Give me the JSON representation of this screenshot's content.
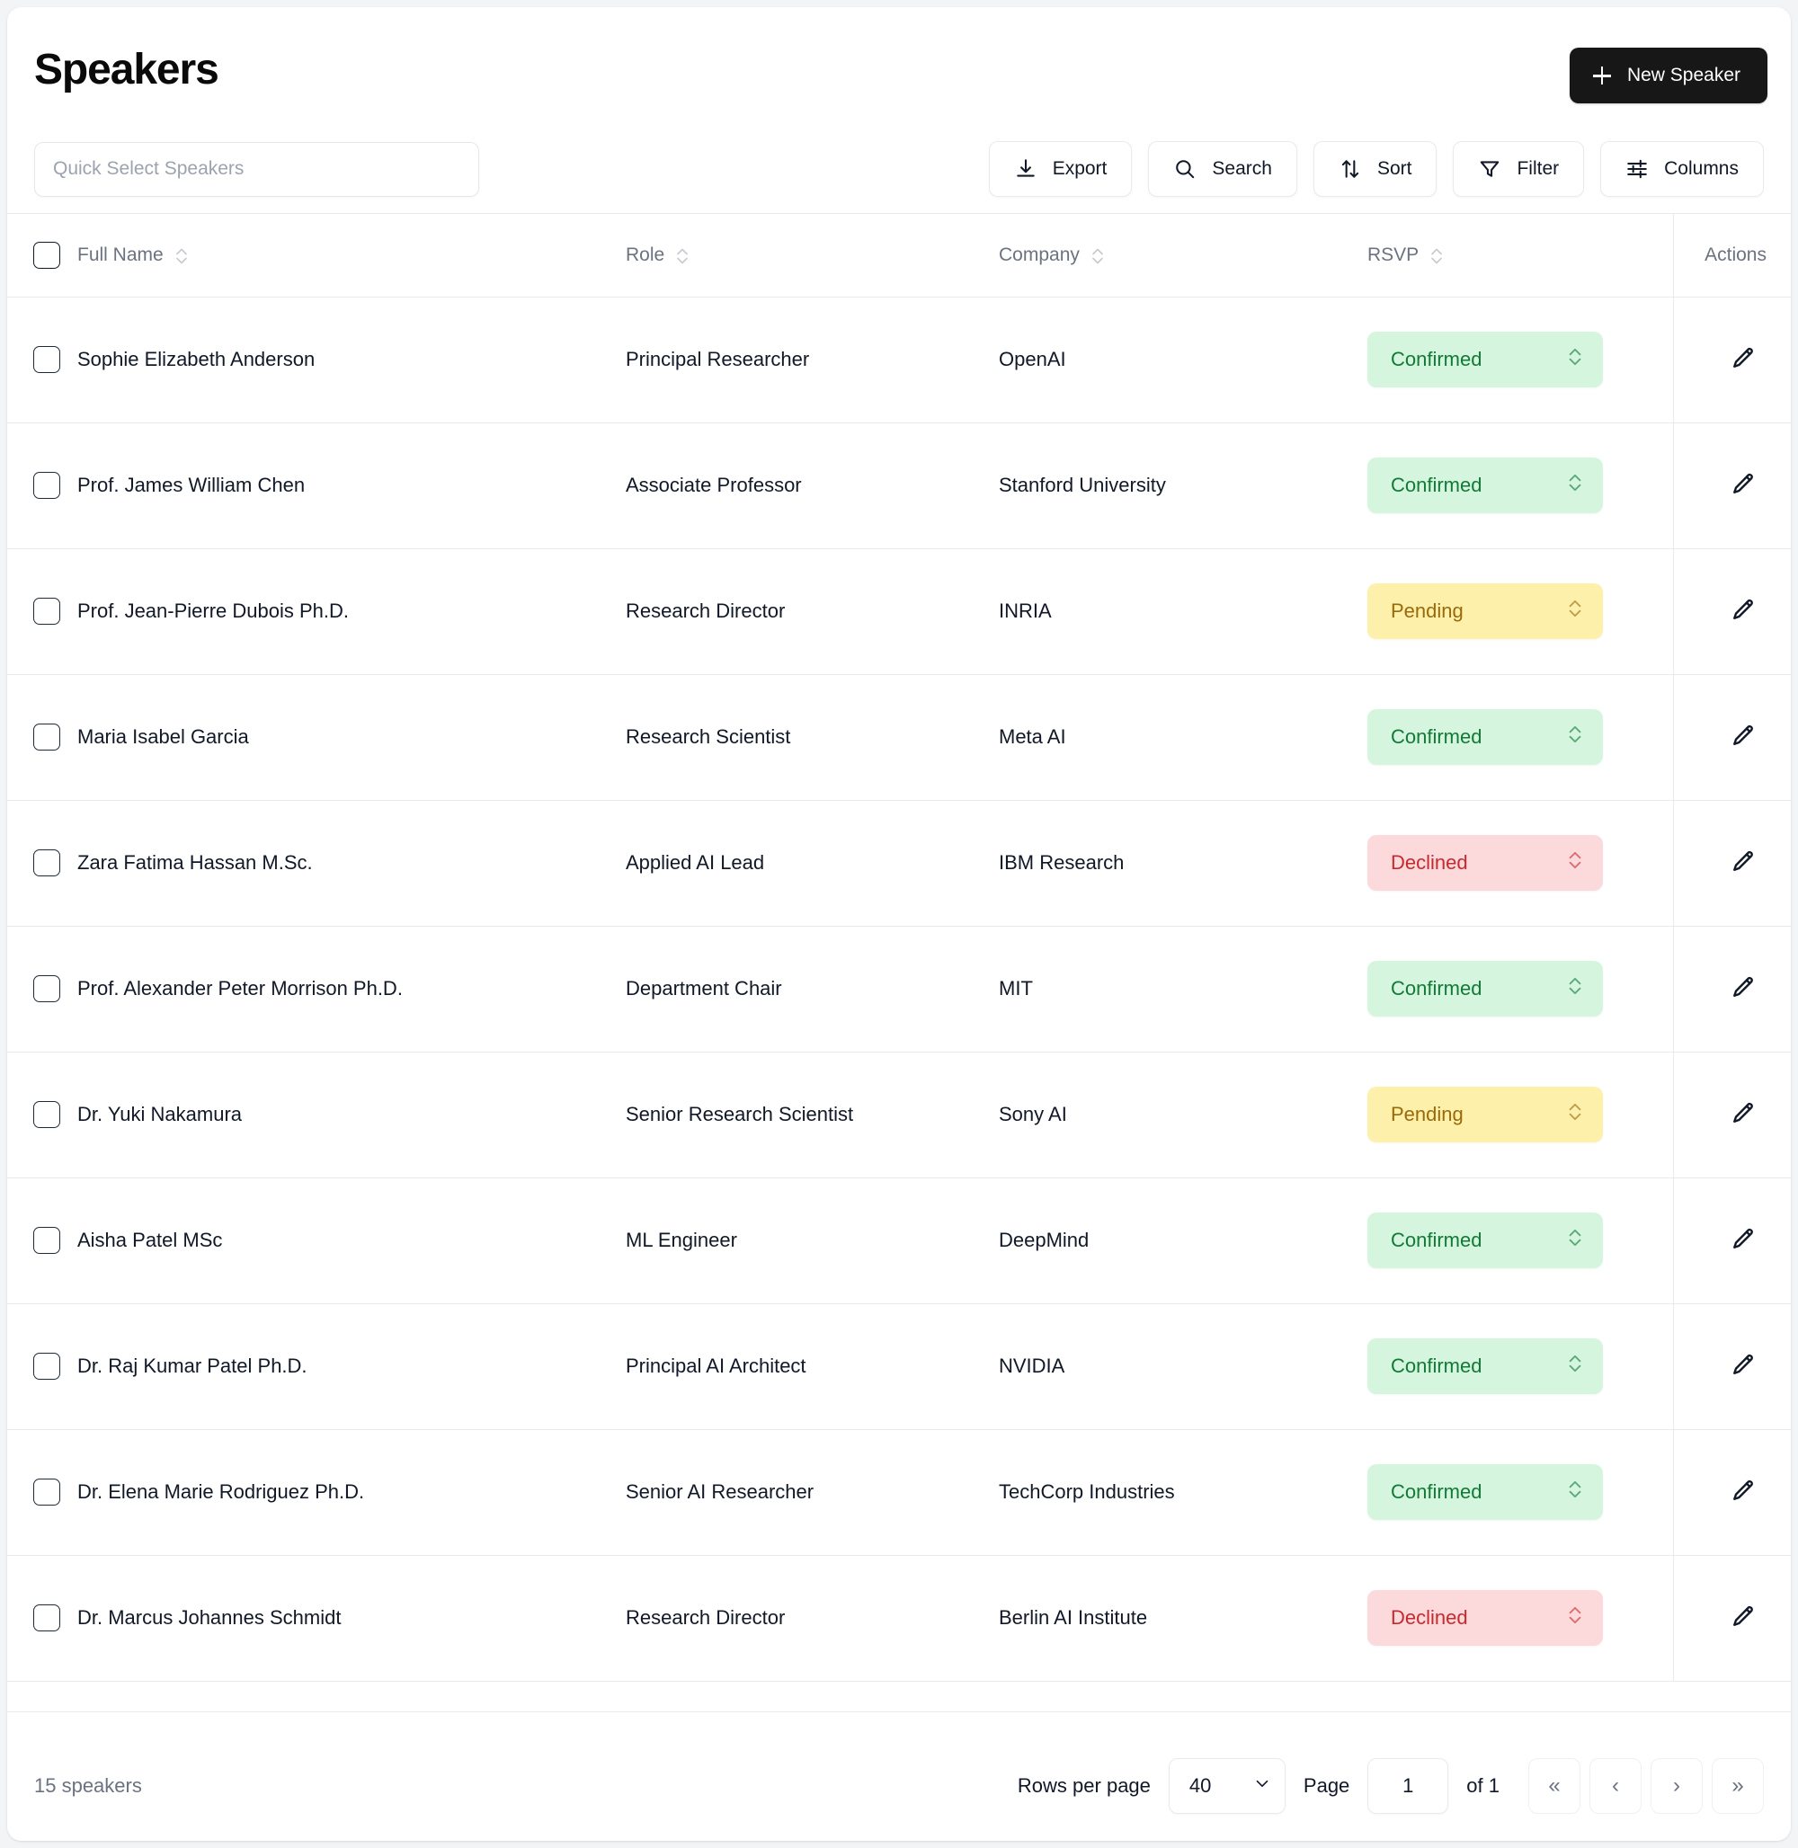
{
  "header": {
    "title": "Speakers",
    "new_button": "New Speaker",
    "new_button_icon": "plus-icon"
  },
  "toolbar": {
    "quick_select_placeholder": "Quick Select Speakers",
    "quick_select_value": "",
    "buttons": [
      {
        "label": "Export",
        "icon": "download-icon"
      },
      {
        "label": "Search",
        "icon": "search-icon"
      },
      {
        "label": "Sort",
        "icon": "sort-arrows-icon"
      },
      {
        "label": "Filter",
        "icon": "funnel-icon"
      },
      {
        "label": "Columns",
        "icon": "sliders-icon"
      }
    ]
  },
  "table": {
    "columns": [
      {
        "key": "name",
        "label": "Full Name",
        "sortable": true
      },
      {
        "key": "role",
        "label": "Role",
        "sortable": true
      },
      {
        "key": "company",
        "label": "Company",
        "sortable": true
      },
      {
        "key": "rsvp",
        "label": "RSVP",
        "sortable": true
      },
      {
        "key": "actions",
        "label": "Actions",
        "sortable": false
      }
    ],
    "rows": [
      {
        "name": "Sophie Elizabeth Anderson",
        "role": "Principal Researcher",
        "company": "OpenAI",
        "rsvp": "Confirmed",
        "rsvp_state": "confirmed"
      },
      {
        "name": "Prof. James William Chen",
        "role": "Associate Professor",
        "company": "Stanford University",
        "rsvp": "Confirmed",
        "rsvp_state": "confirmed"
      },
      {
        "name": "Prof. Jean-Pierre Dubois Ph.D.",
        "role": "Research Director",
        "company": "INRIA",
        "rsvp": "Pending",
        "rsvp_state": "pending"
      },
      {
        "name": "Maria Isabel Garcia",
        "role": "Research Scientist",
        "company": "Meta AI",
        "rsvp": "Confirmed",
        "rsvp_state": "confirmed"
      },
      {
        "name": "Zara Fatima Hassan M.Sc.",
        "role": "Applied AI Lead",
        "company": "IBM Research",
        "rsvp": "Declined",
        "rsvp_state": "declined"
      },
      {
        "name": "Prof. Alexander Peter Morrison Ph.D.",
        "role": "Department Chair",
        "company": "MIT",
        "rsvp": "Confirmed",
        "rsvp_state": "confirmed"
      },
      {
        "name": "Dr. Yuki Nakamura",
        "role": "Senior Research Scientist",
        "company": "Sony AI",
        "rsvp": "Pending",
        "rsvp_state": "pending"
      },
      {
        "name": "Aisha Patel MSc",
        "role": "ML Engineer",
        "company": "DeepMind",
        "rsvp": "Confirmed",
        "rsvp_state": "confirmed"
      },
      {
        "name": "Dr. Raj Kumar Patel Ph.D.",
        "role": "Principal AI Architect",
        "company": "NVIDIA",
        "rsvp": "Confirmed",
        "rsvp_state": "confirmed"
      },
      {
        "name": "Dr. Elena Marie Rodriguez Ph.D.",
        "role": "Senior AI Researcher",
        "company": "TechCorp Industries",
        "rsvp": "Confirmed",
        "rsvp_state": "confirmed"
      },
      {
        "name": "Dr. Marcus Johannes Schmidt",
        "role": "Research Director",
        "company": "Berlin AI Institute",
        "rsvp": "Declined",
        "rsvp_state": "declined"
      }
    ],
    "row_action_icon": "pencil-icon"
  },
  "footer": {
    "count_label": "15 speakers",
    "rows_per_page_label": "Rows per page",
    "rows_per_page_value": "40",
    "page_label": "Page",
    "page_value": "1",
    "of_label": "of 1",
    "first_page": "«",
    "prev_page": "‹",
    "next_page": "›",
    "last_page": "»"
  },
  "colors": {
    "accent_dark": "#171717",
    "confirmed_bg": "#d5f5de",
    "confirmed_fg": "#117a36",
    "pending_bg": "#fdf0ab",
    "pending_fg": "#9a6a09",
    "declined_bg": "#fcd9da",
    "declined_fg": "#c62a2f",
    "border": "#e8eaed",
    "muted_text": "#6b7280"
  }
}
